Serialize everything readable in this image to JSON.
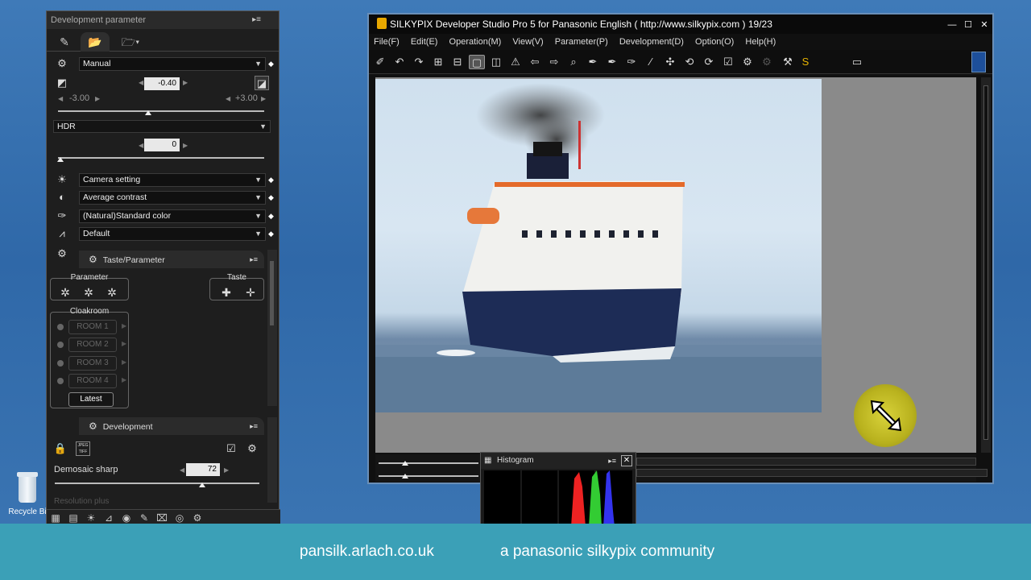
{
  "desktop": {
    "recycle_label": "Recycle Bi"
  },
  "panel": {
    "title": "Development parameter",
    "exposure_mode": "Manual",
    "exposure_value": "-0.40",
    "exposure_min": "-3.00",
    "exposure_max": "+3.00",
    "hdr_label": "HDR",
    "hdr_value": "0",
    "dropdowns": [
      "Camera setting",
      "Average contrast",
      "(Natural)Standard color",
      "Default"
    ],
    "taste_section": "Taste/Parameter",
    "parameter_label": "Parameter",
    "taste_label": "Taste",
    "cloakroom_label": "Cloakroom",
    "rooms": [
      "ROOM 1",
      "ROOM 2",
      "ROOM 3",
      "ROOM 4"
    ],
    "latest_label": "Latest",
    "development_section": "Development",
    "demosaic_label": "Demosaic sharp",
    "demosaic_value": "72",
    "resolution_label": "Resolution plus",
    "jpeg_icon_text": "JPEG TIFF"
  },
  "window": {
    "title": "SILKYPIX Developer Studio Pro 5 for Panasonic English ( http://www.silkypix.com )   19/23",
    "menu": [
      "File(F)",
      "Edit(E)",
      "Operation(M)",
      "View(V)",
      "Parameter(P)",
      "Development(D)",
      "Option(O)",
      "Help(H)"
    ]
  },
  "histogram": {
    "title": "Histogram"
  },
  "footer": {
    "left": "pansilk.arlach.co.uk",
    "right": "a panasonic silkypix community"
  }
}
